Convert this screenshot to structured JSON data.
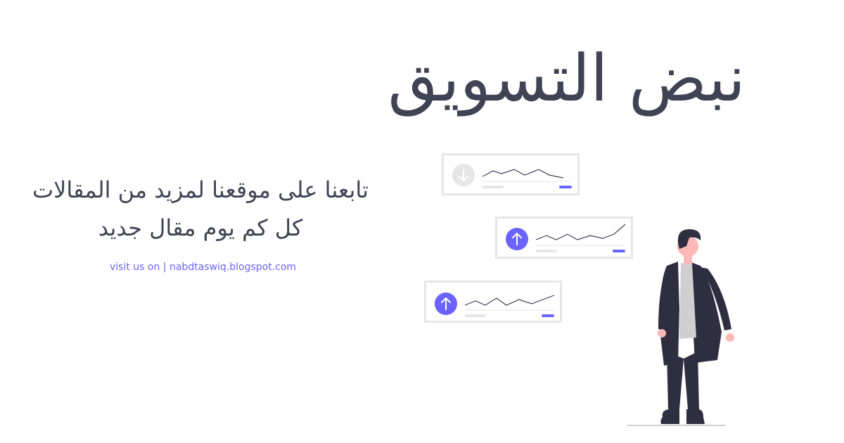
{
  "header": {
    "title": "نبض التسويق"
  },
  "message": {
    "line1": "تابعنا على موقعنا لمزيد من المقالات",
    "line2": "كل كم يوم مقال جديد"
  },
  "footer": {
    "visit_prefix": "visit us on | ",
    "visit_url": "nabdtaswiq.blogspot.com"
  },
  "cards": [
    {
      "trend": "down",
      "icon": "arrow-down-icon"
    },
    {
      "trend": "up",
      "icon": "arrow-up-icon"
    },
    {
      "trend": "up",
      "icon": "arrow-up-icon"
    }
  ],
  "colors": {
    "accent": "#6c63ff",
    "text": "#3f4353",
    "muted": "#e6e6e6",
    "figure_dark": "#2f2e41",
    "skin": "#ffb8b8"
  }
}
